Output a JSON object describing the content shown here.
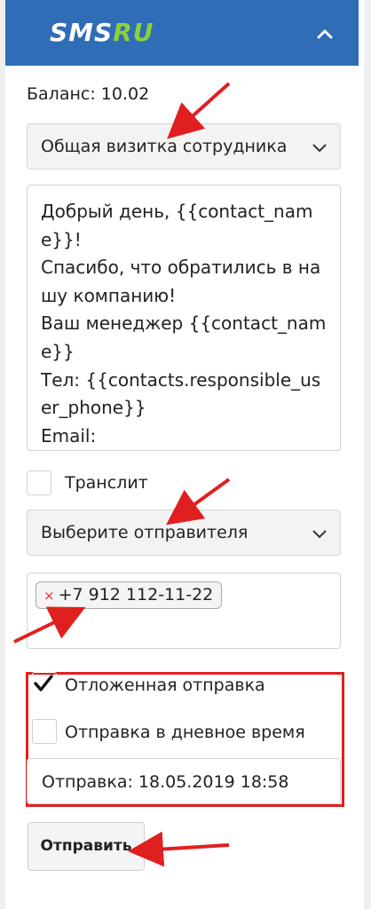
{
  "header": {
    "logo_sms": "SMS",
    "logo_ru": "RU"
  },
  "balance": "Баланс: 10.02",
  "template_select": {
    "value": "Общая визитка сотрудника"
  },
  "message": {
    "text": "Добрый день, {{contact_name}}!\nСпасибо, что обратились в нашу компанию!\nВаш менеджер {{contact_name}}\nТел: {{contacts.responsible_user_phone}}\nEmail:"
  },
  "translit": {
    "label": "Транслит",
    "checked": false
  },
  "sender_select": {
    "value": "Выберите отправителя"
  },
  "phones": {
    "remove_symbol": "×",
    "items": [
      "+7 912 112-11-22"
    ]
  },
  "delayed": {
    "label": "Отложенная отправка",
    "checked": true
  },
  "daytime": {
    "label": "Отправка в дневное время",
    "checked": false
  },
  "send_time": {
    "value": "Отправка: 18.05.2019 18:58"
  },
  "send_button": {
    "label": "Отправить"
  },
  "colors": {
    "header": "#2f6db6",
    "logo_accent": "#8bd13a",
    "annotation": "#e02020"
  }
}
